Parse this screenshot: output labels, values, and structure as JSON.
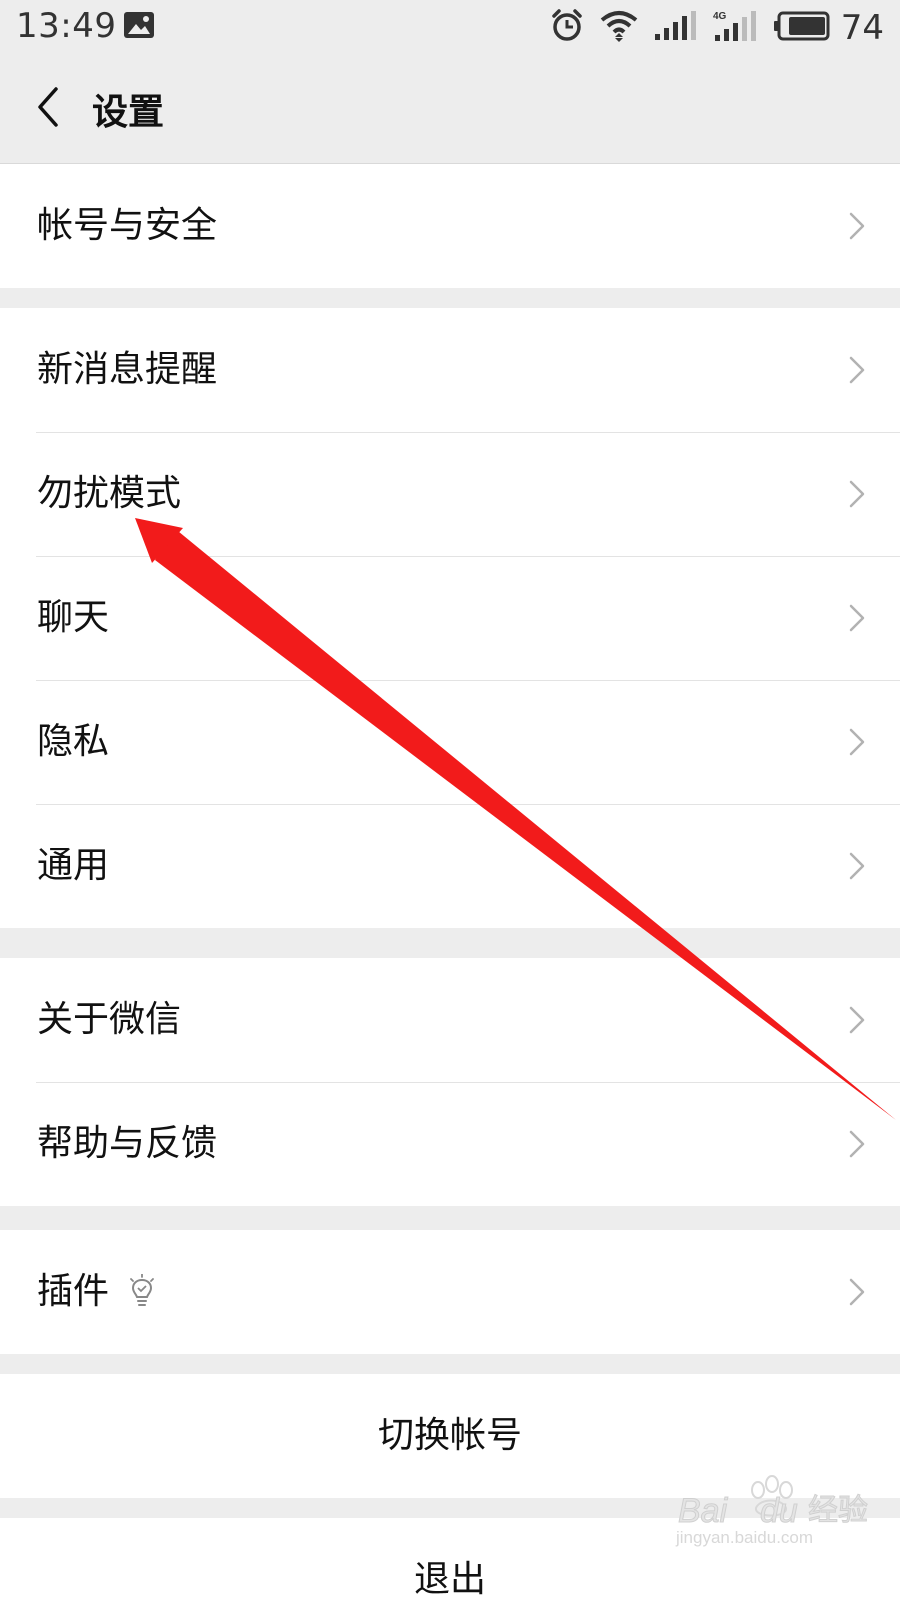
{
  "status_bar": {
    "time": "13:49",
    "battery_level": "74",
    "network_label": "4G",
    "icons": [
      "gallery-icon",
      "alarm-icon",
      "wifi-icon",
      "signal-icon",
      "signal-4g-icon",
      "battery-icon"
    ]
  },
  "header": {
    "title": "设置",
    "back_icon": "chevron-left-icon"
  },
  "groups": {
    "account": {
      "items": [
        {
          "label": "帐号与安全"
        }
      ]
    },
    "general": {
      "items": [
        {
          "label": "新消息提醒"
        },
        {
          "label": "勿扰模式"
        },
        {
          "label": "聊天"
        },
        {
          "label": "隐私"
        },
        {
          "label": "通用"
        }
      ]
    },
    "about": {
      "items": [
        {
          "label": "关于微信"
        },
        {
          "label": "帮助与反馈"
        }
      ]
    },
    "plugins": {
      "items": [
        {
          "label": "插件",
          "icon": "lightbulb-icon"
        }
      ]
    }
  },
  "actions": {
    "switch_account": "切换帐号",
    "logout": "退出"
  },
  "annotation": {
    "color": "#f21b1b"
  },
  "watermark": {
    "url": "jingyan.baidu.com"
  },
  "colors": {
    "background": "#ededed",
    "surface": "#ffffff",
    "chevron": "#b2b2b2"
  }
}
